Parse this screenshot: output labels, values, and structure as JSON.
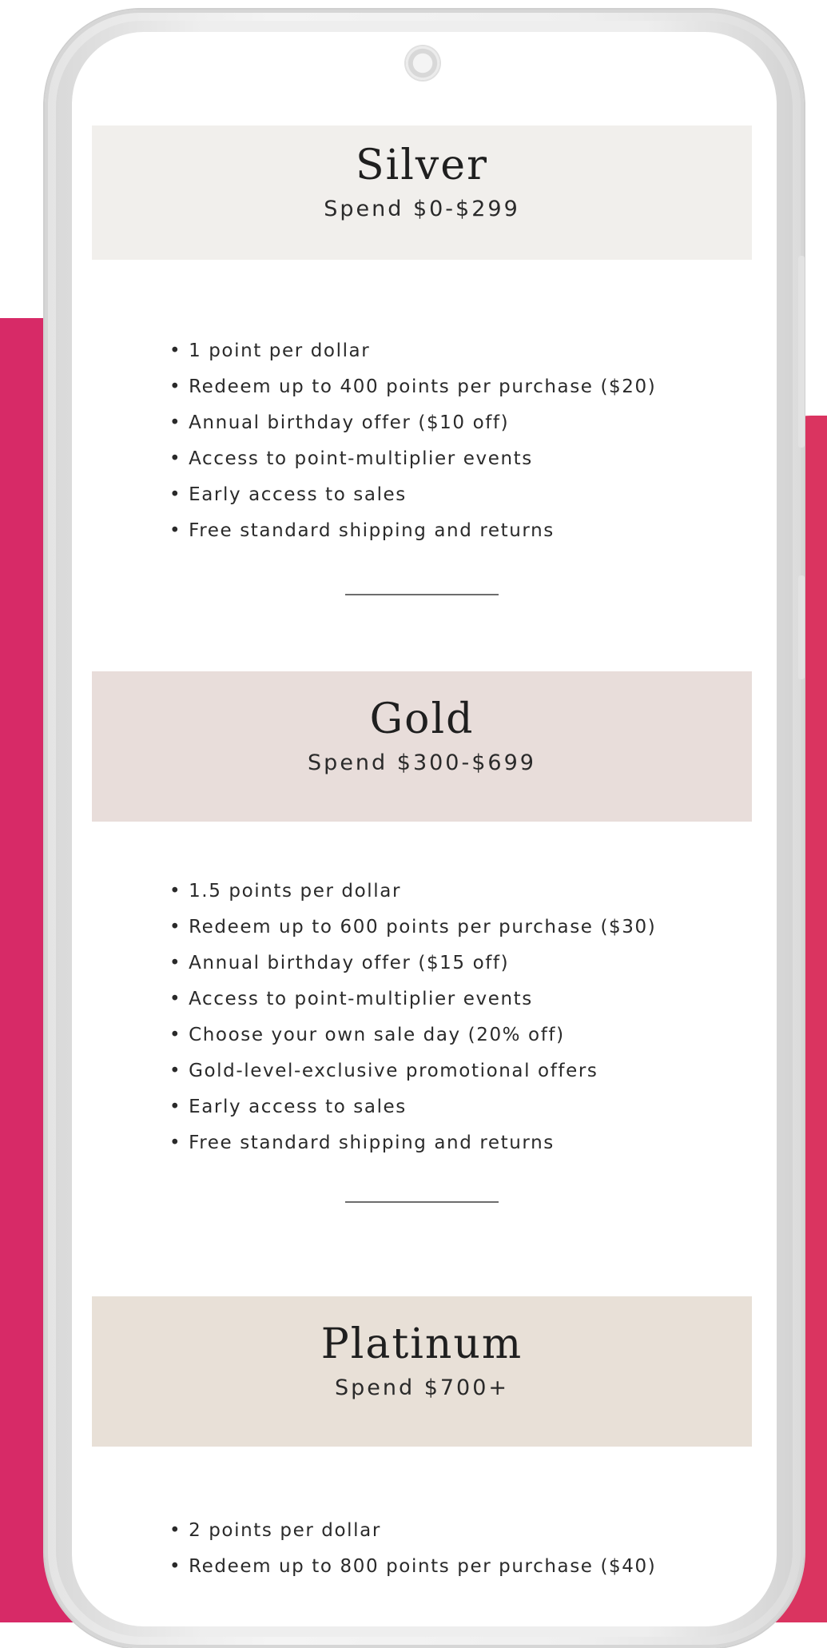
{
  "tiers": [
    {
      "name": "Silver",
      "spend": "Spend $0-$299",
      "header_color": "#f1efec",
      "benefits": [
        "1 point per dollar",
        "Redeem up to 400 points per purchase ($20)",
        "Annual birthday offer ($10 off)",
        "Access to point-multiplier events",
        "Early access to sales",
        "Free standard shipping and returns"
      ]
    },
    {
      "name": "Gold",
      "spend": "Spend $300-$699",
      "header_color": "#e8ddda",
      "benefits": [
        "1.5 points per dollar",
        "Redeem up to 600 points per purchase ($30)",
        "Annual birthday offer ($15 off)",
        "Access to point-multiplier events",
        "Choose your own sale day (20% off)",
        "Gold-level-exclusive promotional offers",
        "Early access to sales",
        "Free standard shipping and returns"
      ]
    },
    {
      "name": "Platinum",
      "spend": "Spend $700+",
      "header_color": "#e8e0d7",
      "benefits": [
        "2 points per dollar",
        "Redeem up to 800 points per purchase ($40)"
      ]
    }
  ],
  "colors": {
    "background_accent": "#d62a68",
    "phone_frame": "#ececec",
    "divider": "#6d6d6d"
  },
  "icons": {
    "camera": "front-camera-icon"
  }
}
